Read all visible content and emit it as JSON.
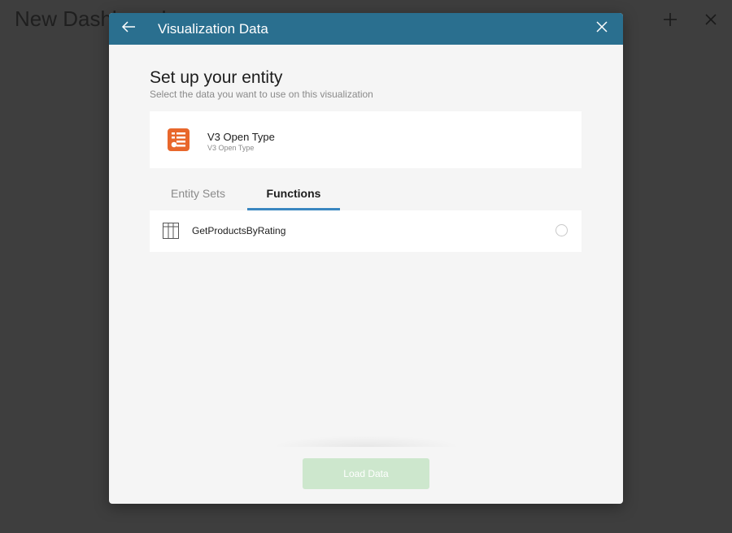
{
  "background": {
    "dashboard_title": "New Dashboard",
    "icons": [
      "plus-icon",
      "close-icon"
    ]
  },
  "modal": {
    "title": "Visualization Data",
    "header_color": "#2a6f8f",
    "heading": "Set up your entity",
    "subheading": "Select the data you want to use on this visualization",
    "source": {
      "name": "V3 Open Type",
      "sub": "V3 Open Type",
      "icon": "odata-table-icon",
      "icon_color": "#e8672c"
    },
    "tabs": [
      {
        "label": "Entity Sets",
        "active": false
      },
      {
        "label": "Functions",
        "active": true
      }
    ],
    "tab_indicator_color": "#3a87c0",
    "functions": [
      {
        "label": "GetProductsByRating",
        "icon": "table-grid-icon",
        "selected": false
      }
    ],
    "load_button": {
      "label": "Load Data",
      "enabled": false,
      "color": "#cde7cd"
    }
  }
}
